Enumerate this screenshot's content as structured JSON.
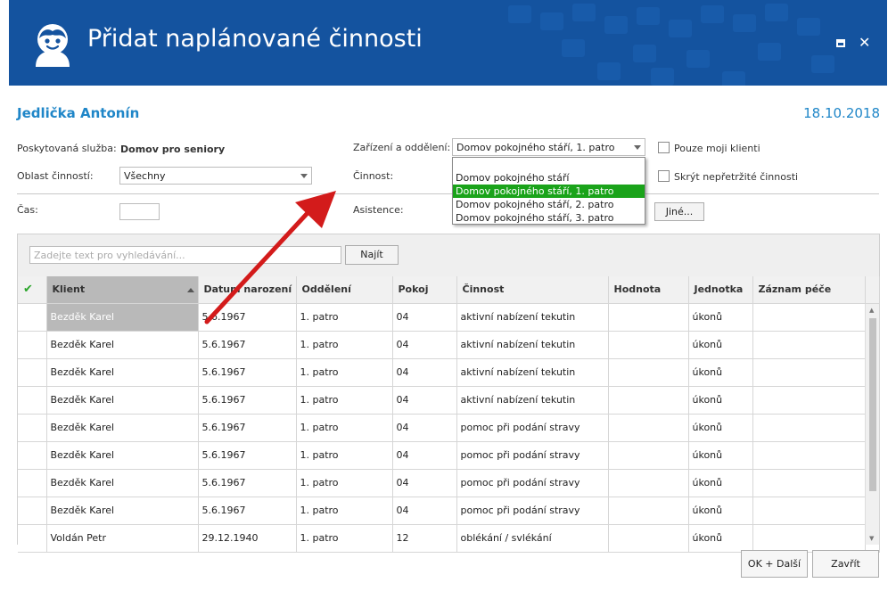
{
  "window": {
    "title": "Přidat naplánované činnosti",
    "brand_color": "#14539f",
    "accent_color": "#1f86c8"
  },
  "client": {
    "name": "Jedlička Antonín",
    "date": "18.10.2018"
  },
  "form": {
    "service_label": "Poskytovaná služba:",
    "service_value": "Domov pro seniory",
    "area_label": "Oblast činností:",
    "area_value": "Všechny",
    "time_label": "Čas:",
    "facility_label": "Zařízení a oddělení:",
    "facility_value": "Domov pokojného stáří, 1. patro",
    "activity_label": "Činnost:",
    "assistance_label": "Asistence:",
    "only_my_clients_label": "Pouze moji klienti",
    "hide_continuous_label": "Skrýt nepřetržité činnosti",
    "other_button": "Jiné..."
  },
  "dropdown": {
    "options": [
      "Domov pokojného stáří",
      "Domov pokojného stáří, 1. patro",
      "Domov pokojného stáří, 2. patro",
      "Domov pokojného stáří, 3. patro"
    ],
    "selected_index": 1,
    "selected_color": "#1aa31a"
  },
  "search": {
    "placeholder": "Zadejte text pro vyhledávání...",
    "button": "Najít"
  },
  "grid": {
    "columns": [
      "Klient",
      "Datum narození",
      "Oddělení",
      "Pokoj",
      "Činnost",
      "Hodnota",
      "Jednotka",
      "Záznam péče"
    ],
    "rows": [
      [
        "Bezděk Karel",
        "5.6.1967",
        "1. patro",
        "04",
        "aktivní nabízení tekutin",
        "",
        "úkonů",
        ""
      ],
      [
        "Bezděk Karel",
        "5.6.1967",
        "1. patro",
        "04",
        "aktivní nabízení tekutin",
        "",
        "úkonů",
        ""
      ],
      [
        "Bezděk Karel",
        "5.6.1967",
        "1. patro",
        "04",
        "aktivní nabízení tekutin",
        "",
        "úkonů",
        ""
      ],
      [
        "Bezděk Karel",
        "5.6.1967",
        "1. patro",
        "04",
        "aktivní nabízení tekutin",
        "",
        "úkonů",
        ""
      ],
      [
        "Bezděk Karel",
        "5.6.1967",
        "1. patro",
        "04",
        "pomoc při podání stravy",
        "",
        "úkonů",
        ""
      ],
      [
        "Bezděk Karel",
        "5.6.1967",
        "1. patro",
        "04",
        "pomoc při podání stravy",
        "",
        "úkonů",
        ""
      ],
      [
        "Bezděk Karel",
        "5.6.1967",
        "1. patro",
        "04",
        "pomoc při podání stravy",
        "",
        "úkonů",
        ""
      ],
      [
        "Bezděk Karel",
        "5.6.1967",
        "1. patro",
        "04",
        "pomoc při podání stravy",
        "",
        "úkonů",
        ""
      ],
      [
        "Voldán Petr",
        "29.12.1940",
        "1. patro",
        "12",
        "oblékání / svlékání",
        "",
        "úkonů",
        ""
      ]
    ]
  },
  "footer": {
    "ok_next": "OK + Další",
    "close": "Zavřít"
  },
  "icons": {
    "logo": "person-avatar-icon",
    "maximize": "maximize-icon",
    "close": "close-icon",
    "check": "check-icon",
    "sort": "sort-ascending-icon",
    "annotation": "red-arrow"
  }
}
